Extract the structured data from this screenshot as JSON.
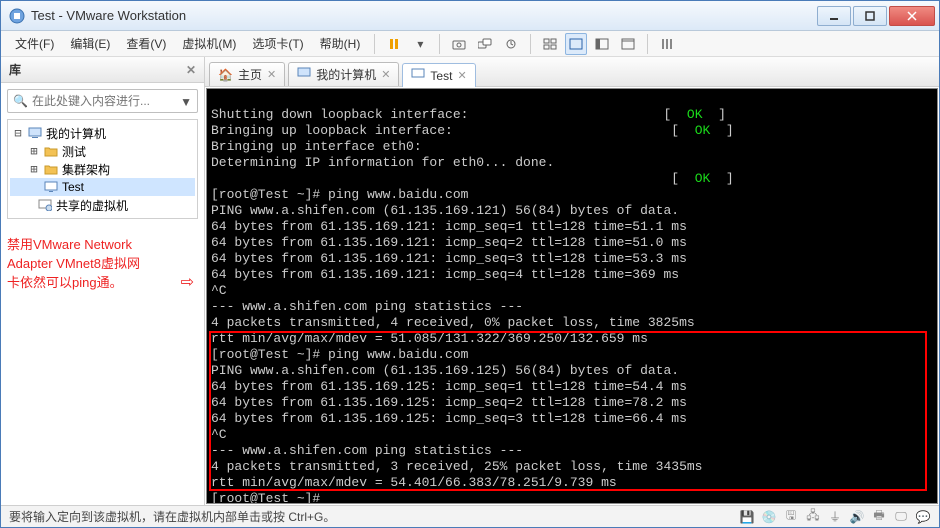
{
  "window": {
    "title": "Test - VMware Workstation"
  },
  "menu": {
    "file": "文件(F)",
    "edit": "编辑(E)",
    "view": "查看(V)",
    "vm": "虚拟机(M)",
    "tabs": "选项卡(T)",
    "help": "帮助(H)"
  },
  "sidebar": {
    "header": "库",
    "search_placeholder": "在此处键入内容进行...",
    "items": {
      "root": "我的计算机",
      "n0": "测试",
      "n1": "集群架构",
      "n2": "Test",
      "shared": "共享的虚拟机"
    },
    "note_l1": "禁用VMware Network",
    "note_l2": "Adapter VMnet8虚拟网",
    "note_l3": "卡依然可以ping通。"
  },
  "tabs": {
    "home": "主页",
    "mypc": "我的计算机",
    "test": "Test"
  },
  "term": {
    "l01a": "Shutting down loopback interface:                         [  ",
    "l01b": "  ]",
    "l02a": "Bringing up loopback interface:                            [  ",
    "l02b": "  ]",
    "l03": "Bringing up interface eth0:",
    "l04": "Determining IP information for eth0... done.",
    "l05a": "                                                           [  ",
    "l05b": "  ]",
    "l06": "[root@Test ~]# ping www.baidu.com",
    "l07": "PING www.a.shifen.com (61.135.169.121) 56(84) bytes of data.",
    "l08": "64 bytes from 61.135.169.121: icmp_seq=1 ttl=128 time=51.1 ms",
    "l09": "64 bytes from 61.135.169.121: icmp_seq=2 ttl=128 time=51.0 ms",
    "l10": "64 bytes from 61.135.169.121: icmp_seq=3 ttl=128 time=53.3 ms",
    "l11": "64 bytes from 61.135.169.121: icmp_seq=4 ttl=128 time=369 ms",
    "l12": "^C",
    "l13": "--- www.a.shifen.com ping statistics ---",
    "l14": "4 packets transmitted, 4 received, 0% packet loss, time 3825ms",
    "l15": "rtt min/avg/max/mdev = 51.085/131.322/369.250/132.659 ms",
    "l16": "[root@Test ~]# ping www.baidu.com",
    "l17": "PING www.a.shifen.com (61.135.169.125) 56(84) bytes of data.",
    "l18": "64 bytes from 61.135.169.125: icmp_seq=1 ttl=128 time=54.4 ms",
    "l19": "64 bytes from 61.135.169.125: icmp_seq=2 ttl=128 time=78.2 ms",
    "l20": "64 bytes from 61.135.169.125: icmp_seq=3 ttl=128 time=66.4 ms",
    "l21": "^C",
    "l22": "--- www.a.shifen.com ping statistics ---",
    "l23": "4 packets transmitted, 3 received, 25% packet loss, time 3435ms",
    "l24": "rtt min/avg/max/mdev = 54.401/66.383/78.251/9.739 ms",
    "l25": "[root@Test ~]#",
    "ok": "OK"
  },
  "status": {
    "text": "要将输入定向到该虚拟机，请在虚拟机内部单击或按 Ctrl+G。"
  }
}
